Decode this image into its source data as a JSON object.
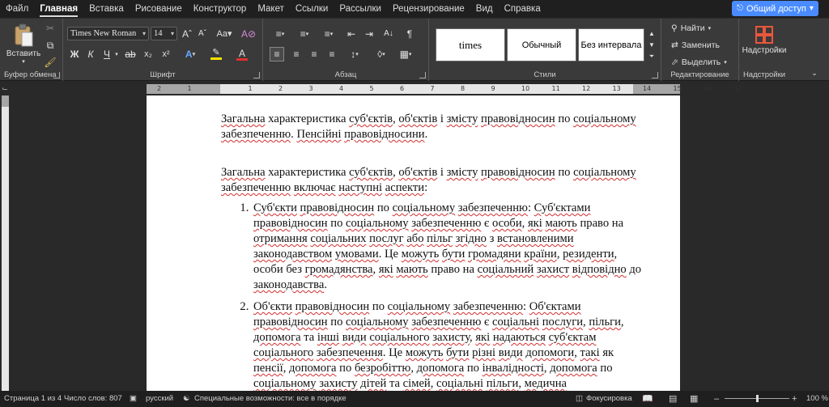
{
  "menu": {
    "tabs": [
      "Файл",
      "Главная",
      "Вставка",
      "Рисование",
      "Конструктор",
      "Макет",
      "Ссылки",
      "Рассылки",
      "Рецензирование",
      "Вид",
      "Справка"
    ],
    "active": "Главная",
    "share_label": "Общий доступ"
  },
  "ribbon": {
    "clipboard": {
      "paste_label": "Вставить",
      "group_label": "Буфер обмена"
    },
    "font": {
      "font_name": "Times New Roman",
      "font_size": "14",
      "group_label": "Шрифт",
      "highlight_color": "#f5e200",
      "font_color": "#e03030"
    },
    "paragraph": {
      "group_label": "Абзац"
    },
    "styles": {
      "items": [
        "times",
        "Обычный",
        "Без интервала"
      ],
      "group_label": "Стили"
    },
    "editing": {
      "find_label": "Найти",
      "replace_label": "Заменить",
      "select_label": "Выделить",
      "group_label": "Редактирование"
    },
    "addins": {
      "label": "Надстройки",
      "group_label": "Надстройки",
      "icon_color": "#e8573c"
    }
  },
  "ruler": {
    "numbers": [
      "1",
      "2",
      "1",
      "2",
      "3",
      "4",
      "5",
      "6",
      "7",
      "8",
      "9",
      "10",
      "11",
      "12",
      "13",
      "14",
      "15",
      "16",
      "17"
    ]
  },
  "document": {
    "title_p": [
      {
        "t": "Загальна",
        "s": "sq"
      },
      {
        "t": " характеристика ",
        "s": ""
      },
      {
        "t": "суб'єктів",
        "s": "sq"
      },
      {
        "t": ", ",
        "s": ""
      },
      {
        "t": "об'єктів",
        "s": "sq"
      },
      {
        "t": " і ",
        "s": ""
      },
      {
        "t": "змісту",
        "s": "sq"
      },
      {
        "t": " ",
        "s": ""
      },
      {
        "t": "правовідносин",
        "s": "sq"
      },
      {
        "t": " по ",
        "s": ""
      },
      {
        "t": "соціальному",
        "s": "sq"
      },
      {
        "t": " ",
        "s": ""
      },
      {
        "t": "забезпеченню",
        "s": "sq"
      },
      {
        "t": ". ",
        "s": ""
      },
      {
        "t": "Пенсійні",
        "s": "sq"
      },
      {
        "t": " ",
        "s": ""
      },
      {
        "t": "правовідносини",
        "s": "sq"
      },
      {
        "t": ".",
        "s": ""
      }
    ],
    "intro_p": [
      {
        "t": "Загальна",
        "s": "sq"
      },
      {
        "t": " характеристика ",
        "s": ""
      },
      {
        "t": "суб'єктів",
        "s": "sq"
      },
      {
        "t": ", ",
        "s": ""
      },
      {
        "t": "об'єктів",
        "s": "sq"
      },
      {
        "t": " і ",
        "s": ""
      },
      {
        "t": "змісту",
        "s": "sq"
      },
      {
        "t": " ",
        "s": ""
      },
      {
        "t": "правовідносин",
        "s": "sq"
      },
      {
        "t": " по ",
        "s": ""
      },
      {
        "t": "соціальному",
        "s": "sq"
      },
      {
        "t": " ",
        "s": ""
      },
      {
        "t": "забезпеченню",
        "s": "sq"
      },
      {
        "t": " ",
        "s": ""
      },
      {
        "t": "включає",
        "s": "sq"
      },
      {
        "t": " ",
        "s": ""
      },
      {
        "t": "наступні",
        "s": "sq"
      },
      {
        "t": " ",
        "s": ""
      },
      {
        "t": "аспекти",
        "s": "sq"
      },
      {
        "t": ":",
        "s": ""
      }
    ],
    "list": [
      [
        {
          "t": "Суб'єкти",
          "s": "sq"
        },
        {
          "t": " ",
          "s": ""
        },
        {
          "t": "правовідносин",
          "s": "sq"
        },
        {
          "t": " по ",
          "s": ""
        },
        {
          "t": "соціальному",
          "s": "sq"
        },
        {
          "t": " ",
          "s": ""
        },
        {
          "t": "забезпеченню",
          "s": "sq"
        },
        {
          "t": ": ",
          "s": ""
        },
        {
          "t": "Суб'єктами",
          "s": "sq"
        },
        {
          "t": " ",
          "s": ""
        },
        {
          "t": "правовідносин",
          "s": "sq"
        },
        {
          "t": " по ",
          "s": ""
        },
        {
          "t": "соціальному",
          "s": "sq"
        },
        {
          "t": " ",
          "s": ""
        },
        {
          "t": "забезпеченню",
          "s": "sq"
        },
        {
          "t": " є ",
          "s": ""
        },
        {
          "t": "особи",
          "s": "sq"
        },
        {
          "t": ", ",
          "s": ""
        },
        {
          "t": "які",
          "s": "sq"
        },
        {
          "t": " ",
          "s": ""
        },
        {
          "t": "мають",
          "s": "sq"
        },
        {
          "t": " право на ",
          "s": ""
        },
        {
          "t": "отримання",
          "s": "sq"
        },
        {
          "t": " ",
          "s": ""
        },
        {
          "t": "соціальних",
          "s": "sq"
        },
        {
          "t": " ",
          "s": ""
        },
        {
          "t": "послуг",
          "s": "sq"
        },
        {
          "t": " ",
          "s": ""
        },
        {
          "t": "або",
          "s": "sq"
        },
        {
          "t": " ",
          "s": ""
        },
        {
          "t": "пільг",
          "s": "sq"
        },
        {
          "t": " ",
          "s": ""
        },
        {
          "t": "згідно",
          "s": "sq"
        },
        {
          "t": " з ",
          "s": ""
        },
        {
          "t": "встановленими",
          "s": "sq"
        },
        {
          "t": " ",
          "s": ""
        },
        {
          "t": "законодавством",
          "s": "sq"
        },
        {
          "t": " ",
          "s": ""
        },
        {
          "t": "умовами",
          "s": "sq"
        },
        {
          "t": ". Це ",
          "s": ""
        },
        {
          "t": "можуть",
          "s": "sq"
        },
        {
          "t": " ",
          "s": ""
        },
        {
          "t": "бути",
          "s": "sq"
        },
        {
          "t": " ",
          "s": ""
        },
        {
          "t": "громадяни",
          "s": "sq"
        },
        {
          "t": " ",
          "s": ""
        },
        {
          "t": "країни",
          "s": "sq"
        },
        {
          "t": ", ",
          "s": ""
        },
        {
          "t": "резиденти",
          "s": "sq"
        },
        {
          "t": ", особи без ",
          "s": ""
        },
        {
          "t": "громадянства",
          "s": "sq"
        },
        {
          "t": ", ",
          "s": ""
        },
        {
          "t": "які",
          "s": "sq"
        },
        {
          "t": " ",
          "s": ""
        },
        {
          "t": "мають",
          "s": "sq"
        },
        {
          "t": " право на ",
          "s": ""
        },
        {
          "t": "соціальний",
          "s": "sq"
        },
        {
          "t": " ",
          "s": ""
        },
        {
          "t": "захист",
          "s": "sq"
        },
        {
          "t": " ",
          "s": ""
        },
        {
          "t": "відповідно",
          "s": "sq"
        },
        {
          "t": " до ",
          "s": ""
        },
        {
          "t": "законодавства",
          "s": "sq"
        },
        {
          "t": ".",
          "s": ""
        }
      ],
      [
        {
          "t": "Об'єкти",
          "s": "sq"
        },
        {
          "t": " ",
          "s": ""
        },
        {
          "t": "правовідносин",
          "s": "sq"
        },
        {
          "t": " по ",
          "s": ""
        },
        {
          "t": "соціальному",
          "s": "sq"
        },
        {
          "t": " ",
          "s": ""
        },
        {
          "t": "забезпеченню",
          "s": "sq"
        },
        {
          "t": ": ",
          "s": ""
        },
        {
          "t": "Об'єктами",
          "s": "sq"
        },
        {
          "t": " ",
          "s": ""
        },
        {
          "t": "правовідносин",
          "s": "sq"
        },
        {
          "t": " по ",
          "s": ""
        },
        {
          "t": "соціальному",
          "s": "sq"
        },
        {
          "t": " ",
          "s": ""
        },
        {
          "t": "забезпеченню",
          "s": "sq"
        },
        {
          "t": " є ",
          "s": ""
        },
        {
          "t": "соціальні",
          "s": "sq"
        },
        {
          "t": " ",
          "s": ""
        },
        {
          "t": "послуги",
          "s": "sq"
        },
        {
          "t": ", ",
          "s": ""
        },
        {
          "t": "пільги",
          "s": "sq"
        },
        {
          "t": ", ",
          "s": ""
        },
        {
          "t": "допомога",
          "s": "sq"
        },
        {
          "t": " та ",
          "s": ""
        },
        {
          "t": "інші",
          "s": "sq"
        },
        {
          "t": " ",
          "s": ""
        },
        {
          "t": "види",
          "s": "sq"
        },
        {
          "t": " ",
          "s": ""
        },
        {
          "t": "соціального",
          "s": "sq"
        },
        {
          "t": " ",
          "s": ""
        },
        {
          "t": "захисту",
          "s": "sq"
        },
        {
          "t": ", ",
          "s": ""
        },
        {
          "t": "які",
          "s": "sq"
        },
        {
          "t": " ",
          "s": ""
        },
        {
          "t": "надаються",
          "s": "sq"
        },
        {
          "t": " ",
          "s": ""
        },
        {
          "t": "суб'єктам",
          "s": "sq"
        },
        {
          "t": " ",
          "s": ""
        },
        {
          "t": "соціального",
          "s": "sq"
        },
        {
          "t": " ",
          "s": ""
        },
        {
          "t": "забезпечення",
          "s": "sq"
        },
        {
          "t": ". Це ",
          "s": ""
        },
        {
          "t": "можуть",
          "s": "sq"
        },
        {
          "t": " ",
          "s": ""
        },
        {
          "t": "бути",
          "s": "sq"
        },
        {
          "t": " ",
          "s": ""
        },
        {
          "t": "різні",
          "s": "sq"
        },
        {
          "t": " ",
          "s": ""
        },
        {
          "t": "види",
          "s": "sq"
        },
        {
          "t": " ",
          "s": ""
        },
        {
          "t": "допомоги",
          "s": "sq"
        },
        {
          "t": ", ",
          "s": ""
        },
        {
          "t": "такі",
          "s": "sq"
        },
        {
          "t": " як ",
          "s": ""
        },
        {
          "t": "пенсії",
          "s": "sq"
        },
        {
          "t": ", ",
          "s": ""
        },
        {
          "t": "допомога",
          "s": "sq"
        },
        {
          "t": " по ",
          "s": ""
        },
        {
          "t": "безробіттю",
          "s": "sq"
        },
        {
          "t": ", ",
          "s": ""
        },
        {
          "t": "допомога",
          "s": "sq"
        },
        {
          "t": " по ",
          "s": ""
        },
        {
          "t": "інвалідності",
          "s": "sq"
        },
        {
          "t": ", ",
          "s": ""
        },
        {
          "t": "допомога",
          "s": "sq"
        },
        {
          "t": " по ",
          "s": ""
        },
        {
          "t": "соціальному",
          "s": "sq"
        },
        {
          "t": " ",
          "s": ""
        },
        {
          "t": "захисту",
          "s": "sq"
        },
        {
          "t": " ",
          "s": ""
        },
        {
          "t": "дітей",
          "s": "sq"
        },
        {
          "t": " та ",
          "s": ""
        },
        {
          "t": "сімей",
          "s": "sq"
        },
        {
          "t": ", ",
          "s": ""
        },
        {
          "t": "соціальні",
          "s": "sq"
        },
        {
          "t": " ",
          "s": ""
        },
        {
          "t": "пільги",
          "s": "sq"
        },
        {
          "t": ", ",
          "s": ""
        },
        {
          "t": "медична",
          "s": "sq"
        },
        {
          "t": "",
          "s": ""
        }
      ]
    ]
  },
  "status": {
    "page": "Страница 1 из 4",
    "words": "Число слов: 807",
    "language": "русский",
    "accessibility": "Специальные возможности: все в порядке",
    "focus": "Фокусировка",
    "zoom": "100 %",
    "zoom_level": 0.5
  }
}
